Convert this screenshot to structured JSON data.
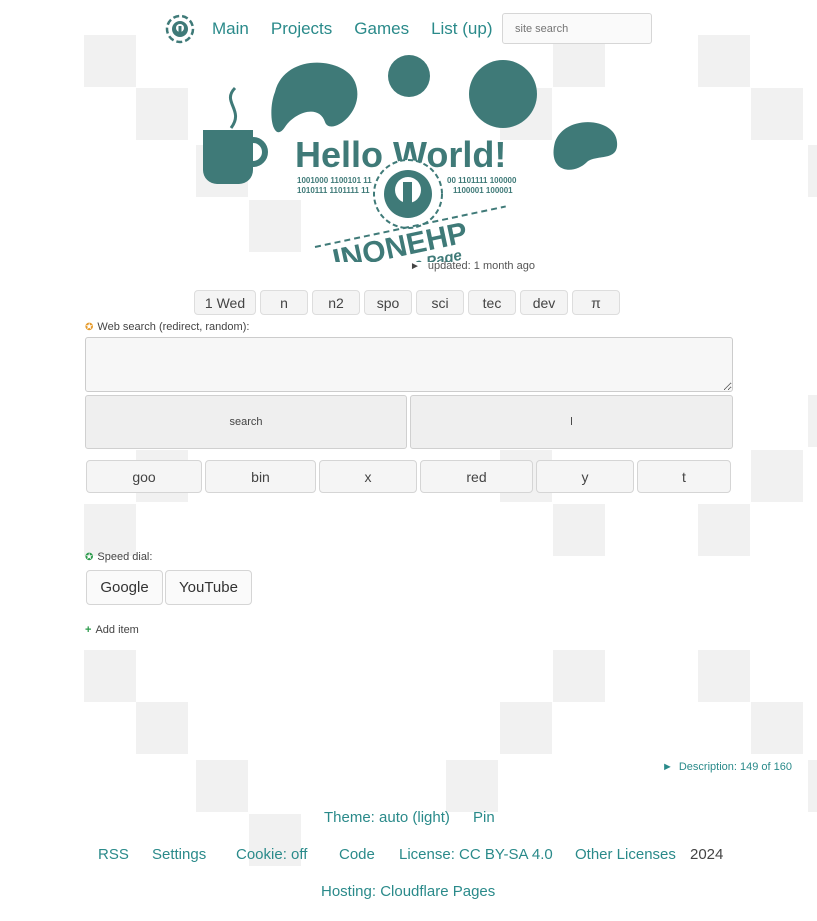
{
  "nav": {
    "items": [
      "Main",
      "Projects",
      "Games",
      "List (up)"
    ],
    "search_placeholder": "site search"
  },
  "hero": {
    "headline": "Hello World!",
    "binary_left": "1001000 1100101 11",
    "binary_left2": "1010111 1101111 11",
    "binary_right": "00 1101111 100000",
    "binary_right2": "1100001 100001",
    "brand": "INONEHP",
    "subtitle": "Home Page"
  },
  "updated": "updated: 1 month ago",
  "tabs": [
    "1 Wed",
    "n",
    "n2",
    "spo",
    "sci",
    "tec",
    "dev",
    "π"
  ],
  "web_search": {
    "label": "Web search (redirect, random):",
    "search_button": "search",
    "lucky_button": "l",
    "engines": [
      "goo",
      "bin",
      "x",
      "red",
      "y",
      "t"
    ]
  },
  "speed_dial": {
    "label": "Speed dial:",
    "items": [
      "Google",
      "YouTube"
    ],
    "add_label": "Add item"
  },
  "description": "Description: 149 of 160",
  "footer": {
    "theme": "Theme: auto (light)",
    "pin": "Pin",
    "rss": "RSS",
    "settings": "Settings",
    "cookie": "Cookie: off",
    "code": "Code",
    "license": "License: CC BY-SA 4.0",
    "other_licenses": "Other Licenses",
    "year": "2024",
    "hosting": "Hosting: Cloudflare Pages"
  },
  "colors": {
    "accent": "#2a8a8a",
    "hero_teal": "#3f7a78",
    "background_squares": "#ececec"
  }
}
